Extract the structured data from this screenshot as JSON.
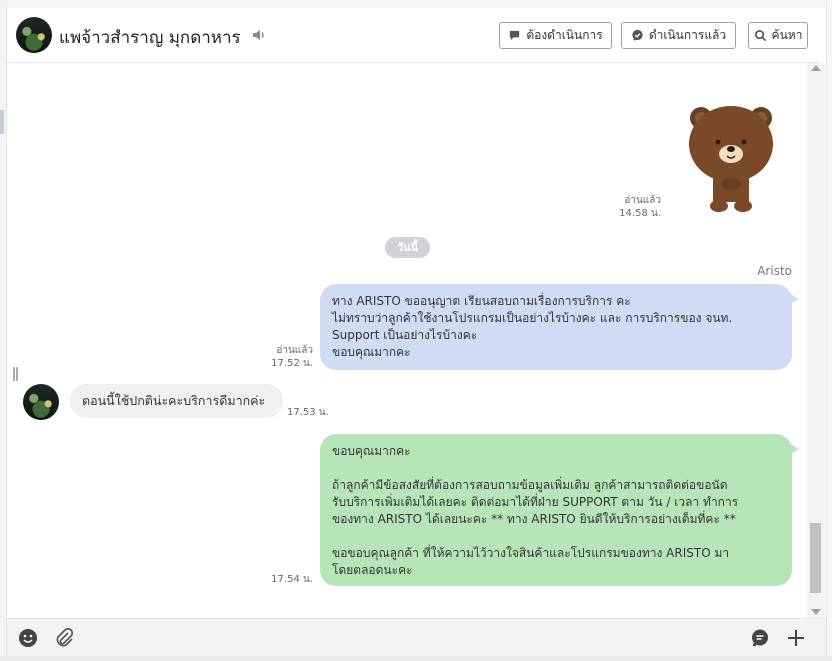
{
  "header": {
    "contact_name": "แพจ้าวสำราญ มุกดาหาร",
    "btn_todo": "ต้องดำเนินการ",
    "btn_done": "ดำเนินการแล้ว",
    "btn_search": "ค้นหา"
  },
  "messages": {
    "sticker": {
      "read": "อ่านแล้ว",
      "time": "14.58 น."
    },
    "day_divider": "วันนี้",
    "sender_name": "Aristo",
    "msg1": {
      "text": "ทาง ARISTO ขออนุญาต เรียนสอบถามเรื่องการบริการ คะ\nไม่ทราบว่าลูกค้าใช้งานโปรแกรมเป็นอย่างไรบ้างคะ และ การบริการของ จนท.\nSupport เป็นอย่างไรบ้างคะ\nขอบคุณมากคะ",
      "read": "อ่านแล้ว",
      "time": "17.52 น."
    },
    "msg2": {
      "text": "ตอนนี้ใช้ปกติน่ะคะบริการดีมากค่ะ",
      "time": "17.53 น."
    },
    "msg3": {
      "text": "ขอบคุณมากคะ\n\nถ้าลูกค้ามีข้อสงสัยที่ต้องการสอบถามข้อมูลเพิ่มเติม ลูกค้าสามารถติดต่อขอนัด\nรับบริการเพิ่มเติมได้เลยคะ ติดต่อมาได้ที่ฝ่าย SUPPORT ตาม วัน / เวลา ทำการ\nของทาง ARISTO ได้เลยนะคะ ** ทาง ARISTO ยินดีให้บริการอย่างเต็มที่คะ **\n\nขอขอบคุณลูกค้า ที่ให้ความไว้วางใจสินค้าและโปรแกรมของทาง ARISTO มา\nโดยตลอดนะคะ",
      "time": "17.54 น."
    }
  },
  "colors": {
    "outgoing_bubble": "#cfdcf4",
    "incoming_bubble": "#eef0f2",
    "template_bubble": "#b6e6b8"
  },
  "icons": [
    "speaker-icon",
    "chat-bubble-icon",
    "chat-check-icon",
    "search-icon",
    "emoji-icon",
    "paperclip-icon",
    "template-icon",
    "plus-icon",
    "bear-sticker"
  ]
}
